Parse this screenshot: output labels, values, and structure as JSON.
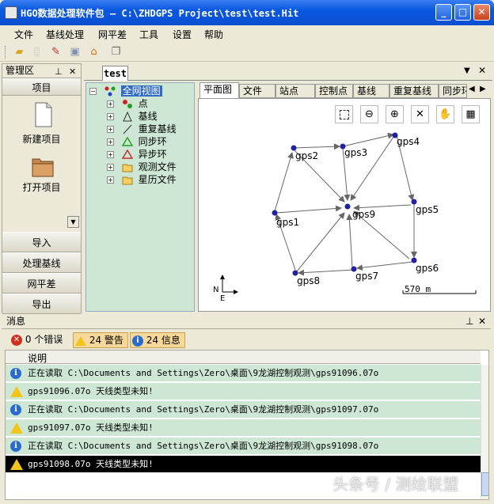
{
  "window": {
    "title": "HGO数据处理软件包 — C:\\ZHDGPS Project\\test\\test.Hit",
    "btn_min": "_",
    "btn_max": "□",
    "btn_close": "✕"
  },
  "menu": [
    "文件",
    "基线处理",
    "网平差",
    "工具",
    "设置",
    "帮助"
  ],
  "toolbar_icons": [
    "open-folder-icon",
    "new-doc-icon",
    "delete-icon",
    "save-icon",
    "home-icon",
    "copy-icon"
  ],
  "manager": {
    "title": "管理区",
    "pin": "ᵖ",
    "close": "✕",
    "project_header": "项目",
    "new_project": "新建项目",
    "open_project": "打开项目",
    "buttons": [
      "导入",
      "处理基线",
      "网平差",
      "导出"
    ]
  },
  "doc_tab": "test",
  "tree": {
    "root": "全网视图",
    "items": [
      "点",
      "基线",
      "重复基线",
      "同步环",
      "异步环",
      "观测文件",
      "星历文件"
    ]
  },
  "view_tabs": [
    "平面图",
    "文件",
    "站点",
    "控制点",
    "基线",
    "重复基线",
    "同步环"
  ],
  "map": {
    "stations": [
      "gps1",
      "gps2",
      "gps3",
      "gps4",
      "gps5",
      "gps6",
      "gps7",
      "gps8",
      "gps9"
    ],
    "scale_label": "570 m",
    "north": "N",
    "east": "E"
  },
  "messages": {
    "title": "消息",
    "errors": "0 个错误",
    "warnings": "24 警告",
    "infos": "24 信息",
    "column": "说明",
    "rows": [
      {
        "type": "info",
        "text": "  正在读取  C:\\Documents and Settings\\Zero\\桌面\\9龙湖控制观测\\gps91096.07o"
      },
      {
        "type": "warn",
        "text": "gps91096.07o  天线类型未知!"
      },
      {
        "type": "info",
        "text": "  正在读取  C:\\Documents and Settings\\Zero\\桌面\\9龙湖控制观测\\gps91097.07o"
      },
      {
        "type": "warn",
        "text": "gps91097.07o  天线类型未知!"
      },
      {
        "type": "info",
        "text": "  正在读取  C:\\Documents and Settings\\Zero\\桌面\\9龙湖控制观测\\gps91098.07o"
      },
      {
        "type": "warn",
        "text": "gps91098.07o  天线类型未知!"
      }
    ]
  },
  "watermark": "头条号 / 测绘联盟",
  "colors": {
    "title_bar": "#0b4fd0",
    "tree_bg": "#cde7d4",
    "station": "#2020a0",
    "selected_row": "#000000"
  }
}
